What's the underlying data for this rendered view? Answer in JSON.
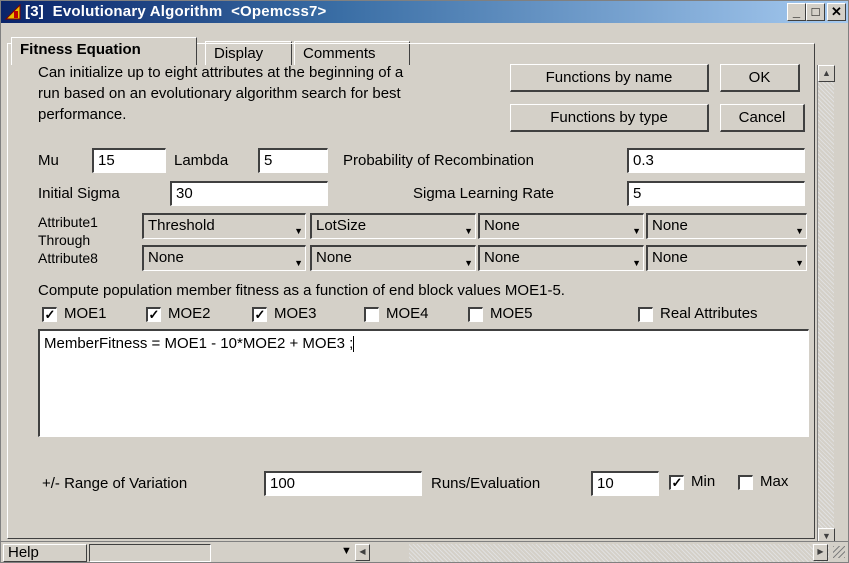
{
  "window": {
    "title": "[3]  Evolutionary Algorithm  <Opemcss7>",
    "minimize": "_",
    "maximize": "□",
    "close": "✕"
  },
  "tabs": [
    {
      "label": "Fitness Equation",
      "active": true
    },
    {
      "label": "Display",
      "active": false
    },
    {
      "label": "Comments",
      "active": false
    }
  ],
  "description": [
    "Can initialize up to eight attributes at the beginning of a",
    "run based on an evolutionary algorithm search for best",
    "performance."
  ],
  "buttons": {
    "functions_by_name": "Functions by name",
    "ok": "OK",
    "functions_by_type": "Functions by type",
    "cancel": "Cancel"
  },
  "params": {
    "mu_label": "Mu",
    "mu_value": "15",
    "lambda_label": "Lambda",
    "lambda_value": "5",
    "prob_recomb_label": "Probability of Recombination",
    "prob_recomb_value": "0.3",
    "initial_sigma_label": "Initial Sigma",
    "initial_sigma_value": "30",
    "sigma_lr_label": "Sigma Learning Rate",
    "sigma_lr_value": "5"
  },
  "attributes": {
    "label_line1": "Attribute1",
    "label_line2": "Through",
    "label_line3": "Attribute8",
    "row1": [
      "Threshold",
      "LotSize",
      "None",
      "None"
    ],
    "row2": [
      "None",
      "None",
      "None",
      "None"
    ]
  },
  "fitness_caption": "Compute population member fitness as a function of end block values MOE1-5.",
  "moe": [
    {
      "label": "MOE1",
      "checked": true
    },
    {
      "label": "MOE2",
      "checked": true
    },
    {
      "label": "MOE3",
      "checked": true
    },
    {
      "label": "MOE4",
      "checked": false
    },
    {
      "label": "MOE5",
      "checked": false
    }
  ],
  "real_attributes": {
    "label": "Real Attributes",
    "checked": false
  },
  "equation": "MemberFitness =  MOE1 - 10*MOE2 + MOE3 ;",
  "bottom": {
    "range_label": "+/- Range of Variation",
    "range_value": "100",
    "runs_label": "Runs/Evaluation",
    "runs_value": "10",
    "min_label": "Min",
    "min_checked": true,
    "max_label": "Max",
    "max_checked": false
  },
  "status": {
    "help": "Help"
  },
  "icons": {
    "app": "app-icon",
    "dropdown": "chevron-down-icon"
  }
}
